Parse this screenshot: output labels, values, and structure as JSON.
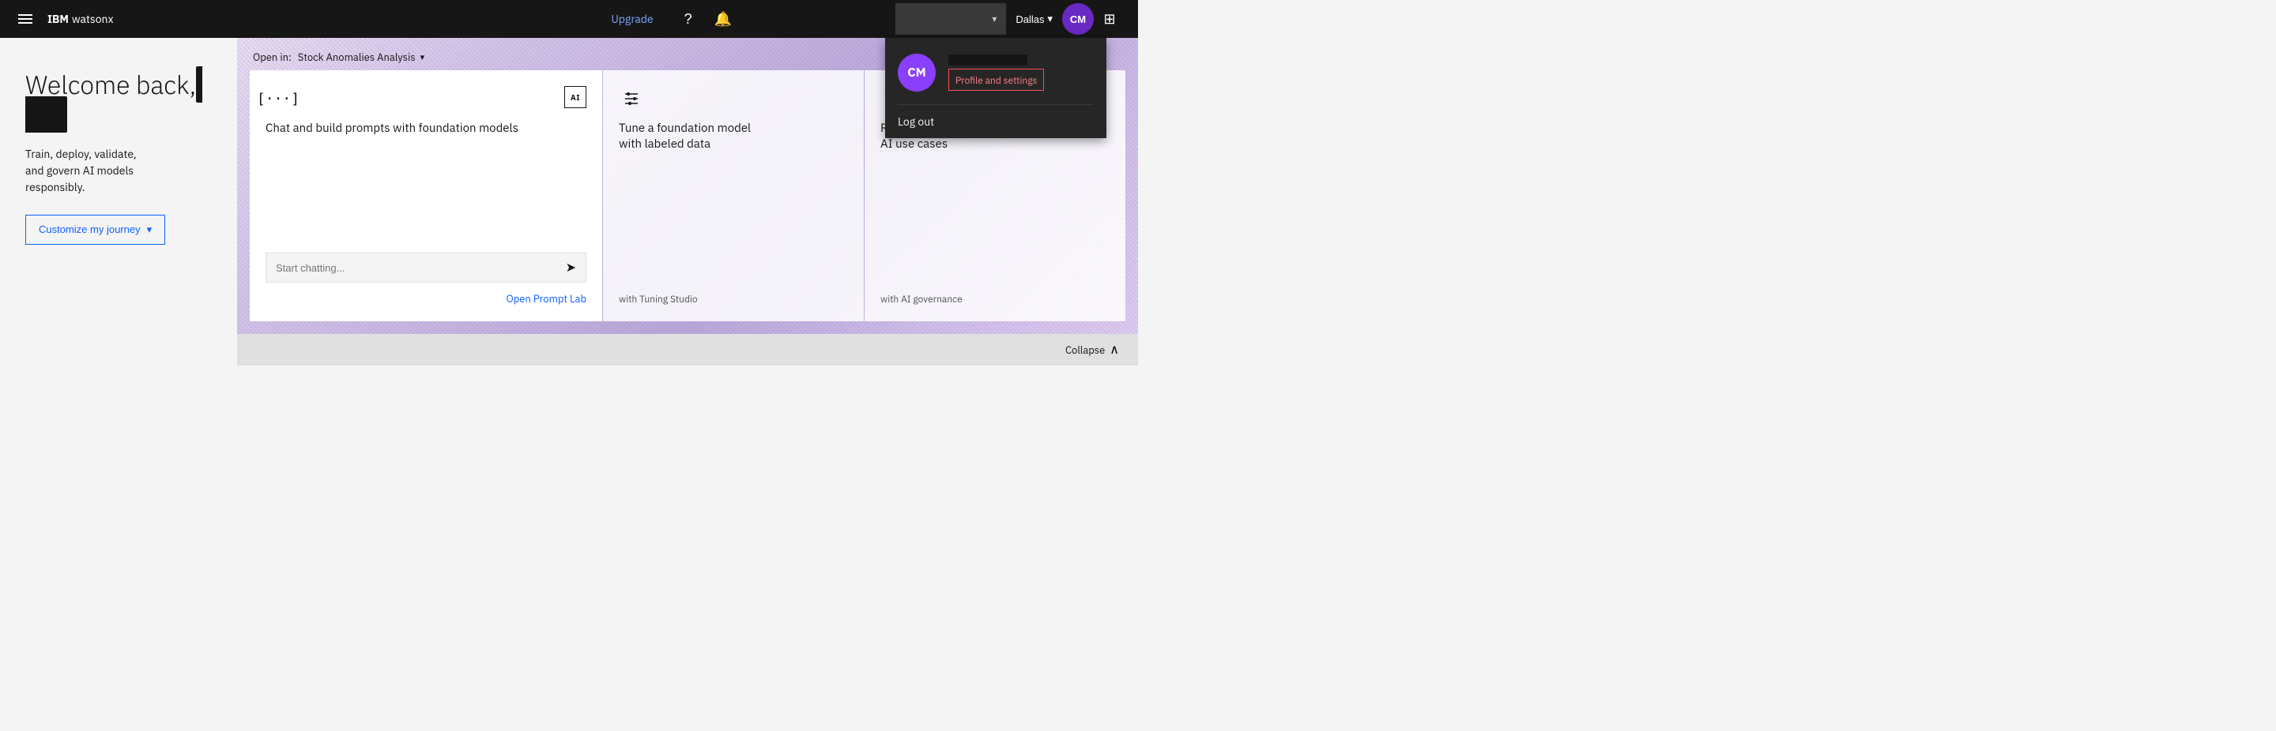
{
  "topbar": {
    "brand_ibm": "IBM",
    "brand_product": "watsonx",
    "upgrade_label": "Upgrade",
    "search_placeholder": "",
    "region": "Dallas",
    "avatar_initials": "CM",
    "hamburger_icon": "menu-icon",
    "help_icon": "help-icon",
    "notification_icon": "notification-icon",
    "chevron_down": "▾",
    "apps_icon": "apps-icon"
  },
  "profile_dropdown": {
    "avatar_initials": "CM",
    "name_hidden": true,
    "profile_settings_label": "Profile and settings",
    "logout_label": "Log out"
  },
  "main": {
    "welcome_title": "Welcome back,",
    "welcome_name": "",
    "tagline": "Train, deploy, validate,\nand govern AI models\nresponsibly.",
    "customize_btn_label": "Customize my journey",
    "customize_chevron": "▾",
    "open_in_label": "Open in:",
    "open_in_value": "Stock Anomalies Analysis",
    "open_in_chevron": "▾",
    "cards": [
      {
        "id": "prompt-lab",
        "icon_type": "bracket",
        "icon_label": "AI",
        "title": "Chat and build prompts with foundation models",
        "chat_placeholder": "Start chatting...",
        "send_icon": "➤",
        "action_label": "Open Prompt Lab"
      },
      {
        "id": "tuning-studio",
        "icon_type": "sliders",
        "title": "Tune a foundation model\nwith labeled data",
        "subtitle": "with Tuning Studio"
      },
      {
        "id": "ai-governance",
        "icon_type": "scales",
        "title": "Request or track models in\nAI use cases",
        "subtitle": "with AI governance"
      }
    ],
    "collapse_label": "Collapse",
    "collapse_icon": "chevron-up-icon"
  }
}
